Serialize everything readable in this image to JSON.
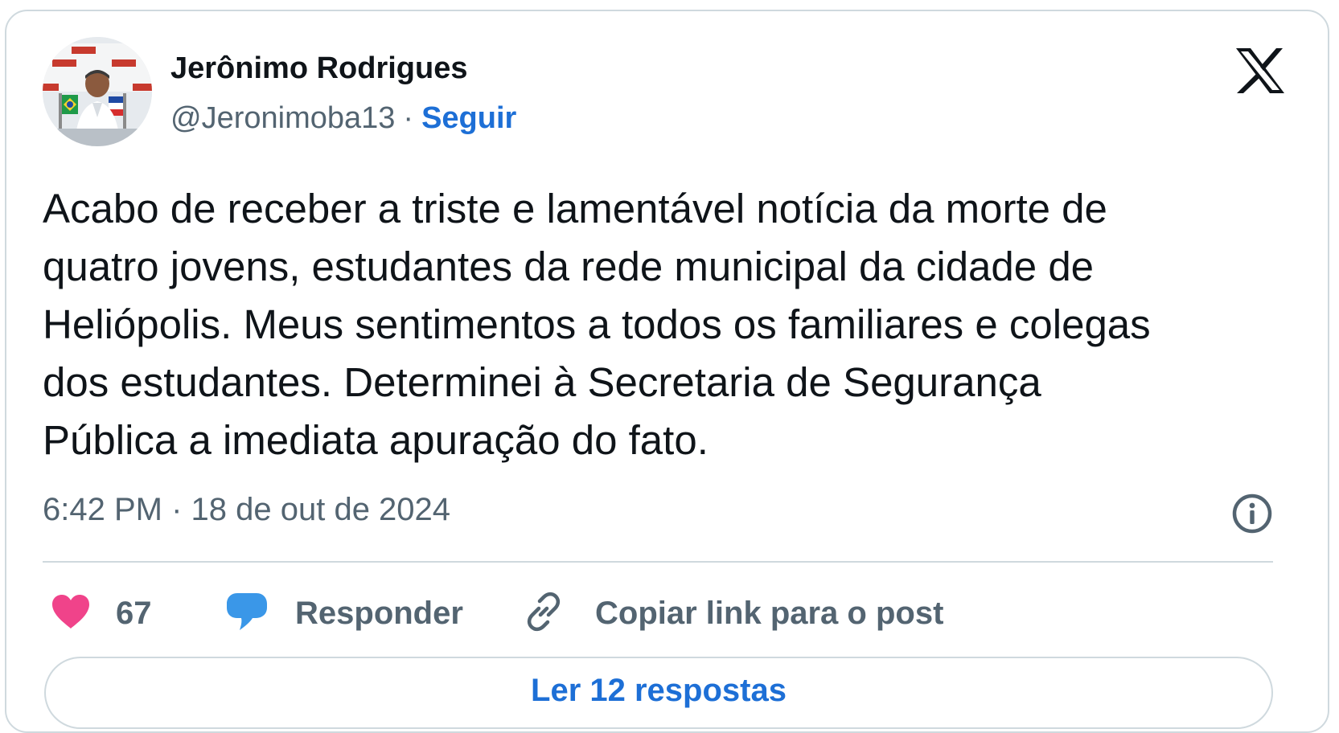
{
  "author": {
    "name": "Jerônimo Rodrigues",
    "handle": "@Jeronimoba13",
    "separator": "·",
    "follow_label": "Seguir"
  },
  "post": {
    "text": "Acabo de receber a triste e lamentável notícia da morte de\nquatro jovens, estudantes da rede municipal da cidade de\nHeliópolis. Meus sentimentos a todos os familiares e colegas\ndos estudantes. Determinei à Secretaria de Segurança\nPública a imediata apuração do fato.",
    "timestamp": "6:42 PM · 18 de out de 2024"
  },
  "actions": {
    "like_count": "67",
    "reply_label": "Responder",
    "copy_link_label": "Copiar link para o post"
  },
  "footer": {
    "read_replies_label": "Ler 12 respostas"
  },
  "icons": {
    "logo": "x-logo-icon",
    "info": "info-icon",
    "like": "heart-icon",
    "reply": "speech-bubble-icon",
    "copy": "link-icon"
  },
  "colors": {
    "text": "#0f1419",
    "secondary_text": "#536471",
    "link": "#1d6fd6",
    "like": "#f0438a",
    "reply": "#3a97e8",
    "border": "#cfd9de"
  }
}
